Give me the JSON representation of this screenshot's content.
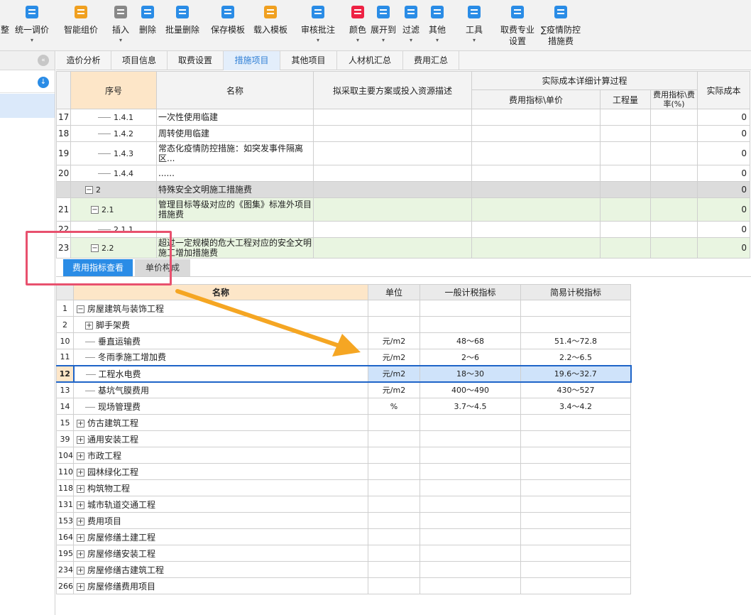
{
  "toolbar": {
    "items": [
      {
        "label": "整",
        "icon": "partial-icon"
      },
      {
        "label": "统一调价",
        "icon": "adjust-price-icon"
      },
      {
        "label": "智能组价",
        "icon": "smart-price-icon"
      },
      {
        "label": "插入",
        "icon": "insert-icon"
      },
      {
        "label": "删除",
        "icon": "delete-icon"
      },
      {
        "label": "批量删除",
        "icon": "batch-delete-icon"
      },
      {
        "label": "保存模板",
        "icon": "save-template-icon"
      },
      {
        "label": "载入模板",
        "icon": "load-template-icon"
      },
      {
        "label": "审核批注",
        "icon": "review-comment-icon"
      },
      {
        "label": "颜色",
        "icon": "color-icon"
      },
      {
        "label": "展开到",
        "icon": "expand-to-icon"
      },
      {
        "label": "过滤",
        "icon": "filter-icon"
      },
      {
        "label": "其他",
        "icon": "other-icon"
      },
      {
        "label": "工具",
        "icon": "tools-icon"
      },
      {
        "label": "取费专业\n设置",
        "icon": "fee-setting-icon"
      },
      {
        "label": "∑疫情防控\n措施费",
        "icon": "epidemic-fee-icon"
      }
    ],
    "dropdown_arrow": "▾"
  },
  "left_panel": {
    "collapse_icon": "«",
    "download_icon": "↓"
  },
  "tabs": [
    "造价分析",
    "项目信息",
    "取费设置",
    "措施项目",
    "其他项目",
    "人材机汇总",
    "费用汇总"
  ],
  "active_tab": "措施项目",
  "top_table": {
    "headers": {
      "seq": "序号",
      "name": "名称",
      "desc": "拟采取主要方案或投入资源描述",
      "group": "实际成本详细计算过程",
      "unit_price": "费用指标\\单价",
      "quantity": "工程量",
      "rate": "费用指标\\费率(%)",
      "actual": "实际成本"
    },
    "rows": [
      {
        "no": "17",
        "code": "1.4.1",
        "name": "一次性使用临建",
        "value": "0",
        "style": "plain",
        "level": 3
      },
      {
        "no": "18",
        "code": "1.4.2",
        "name": "周转使用临建",
        "value": "0",
        "style": "plain",
        "level": 3
      },
      {
        "no": "19",
        "code": "1.4.3",
        "name": "常态化疫情防控措施：如突发事件隔离区...",
        "value": "0",
        "style": "plain",
        "level": 3
      },
      {
        "no": "20",
        "code": "1.4.4",
        "name": "......",
        "value": "0",
        "style": "plain",
        "level": 3
      },
      {
        "no": "",
        "code": "2",
        "name": "特殊安全文明施工措施费",
        "value": "0",
        "style": "grey",
        "level": 1
      },
      {
        "no": "21",
        "code": "2.1",
        "name": "管理目标等级对应的《图集》标准外项目措施费",
        "value": "0",
        "style": "green",
        "level": 2
      },
      {
        "no": "22",
        "code": "2.1.1",
        "name": "",
        "value": "0",
        "style": "plain",
        "level": 3
      },
      {
        "no": "23",
        "code": "2.2",
        "name": "超过一定规模的危大工程对应的安全文明施工增加措施费",
        "value": "0",
        "style": "green",
        "level": 2
      }
    ]
  },
  "lower_tabs": [
    "费用指标查看",
    "单价构成"
  ],
  "bottom_table": {
    "headers": [
      "名称",
      "单位",
      "一般计税指标",
      "简易计税指标"
    ],
    "rows": [
      {
        "no": "1",
        "name": "房屋建筑与装饰工程",
        "unit": "",
        "general": "",
        "simple": "",
        "expander": "−",
        "indent": 0
      },
      {
        "no": "2",
        "name": "脚手架费",
        "unit": "",
        "general": "",
        "simple": "",
        "expander": "+",
        "indent": 1
      },
      {
        "no": "10",
        "name": "垂直运输费",
        "unit": "元/m2",
        "general": "48～68",
        "simple": "51.4～72.8",
        "expander": "",
        "indent": 1
      },
      {
        "no": "11",
        "name": "冬雨季施工增加费",
        "unit": "元/m2",
        "general": "2～6",
        "simple": "2.2～6.5",
        "expander": "",
        "indent": 1
      },
      {
        "no": "12",
        "name": "工程水电费",
        "unit": "元/m2",
        "general": "18～30",
        "simple": "19.6～32.7",
        "expander": "",
        "indent": 1,
        "selected": true
      },
      {
        "no": "13",
        "name": "基坑气膜费用",
        "unit": "元/m2",
        "general": "400～490",
        "simple": "430～527",
        "expander": "",
        "indent": 1
      },
      {
        "no": "14",
        "name": "现场管理费",
        "unit": "%",
        "general": "3.7～4.5",
        "simple": "3.4～4.2",
        "expander": "",
        "indent": 1
      },
      {
        "no": "15",
        "name": "仿古建筑工程",
        "unit": "",
        "general": "",
        "simple": "",
        "expander": "+",
        "indent": 0
      },
      {
        "no": "39",
        "name": "通用安装工程",
        "unit": "",
        "general": "",
        "simple": "",
        "expander": "+",
        "indent": 0
      },
      {
        "no": "104",
        "name": "市政工程",
        "unit": "",
        "general": "",
        "simple": "",
        "expander": "+",
        "indent": 0
      },
      {
        "no": "110",
        "name": "园林绿化工程",
        "unit": "",
        "general": "",
        "simple": "",
        "expander": "+",
        "indent": 0
      },
      {
        "no": "118",
        "name": "构筑物工程",
        "unit": "",
        "general": "",
        "simple": "",
        "expander": "+",
        "indent": 0
      },
      {
        "no": "131",
        "name": "城市轨道交通工程",
        "unit": "",
        "general": "",
        "simple": "",
        "expander": "+",
        "indent": 0
      },
      {
        "no": "153",
        "name": "费用项目",
        "unit": "",
        "general": "",
        "simple": "",
        "expander": "+",
        "indent": 0
      },
      {
        "no": "164",
        "name": "房屋修缮土建工程",
        "unit": "",
        "general": "",
        "simple": "",
        "expander": "+",
        "indent": 0
      },
      {
        "no": "195",
        "name": "房屋修缮安装工程",
        "unit": "",
        "general": "",
        "simple": "",
        "expander": "+",
        "indent": 0
      },
      {
        "no": "234",
        "name": "房屋修缮古建筑工程",
        "unit": "",
        "general": "",
        "simple": "",
        "expander": "+",
        "indent": 0
      },
      {
        "no": "266",
        "name": "房屋修缮费用项目",
        "unit": "",
        "general": "",
        "simple": "",
        "expander": "+",
        "indent": 0
      }
    ]
  },
  "colors": {
    "accent": "#2a8ce6",
    "highlight_box": "#e8516e",
    "arrow": "#f5a623"
  }
}
